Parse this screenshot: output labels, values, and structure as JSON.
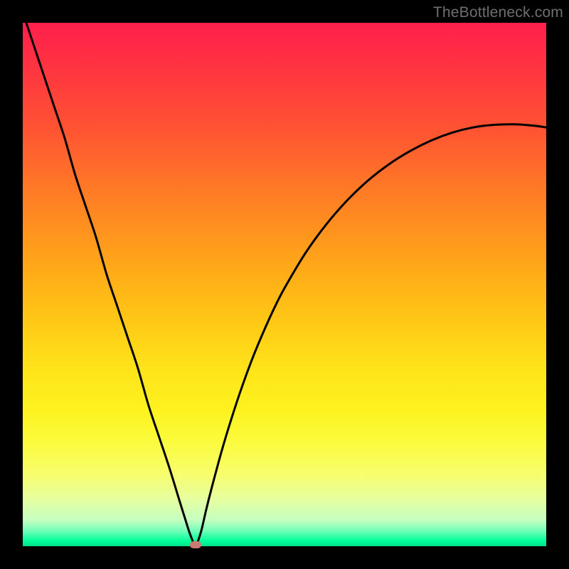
{
  "watermark": "TheBottleneck.com",
  "colors": {
    "frame_bg": "#000000",
    "curve_stroke": "#000000",
    "min_marker": "#c97b72",
    "watermark": "#6f6f6f",
    "gradient_top": "#ff1f4c",
    "gradient_bottom": "#00e089"
  },
  "chart_data": {
    "type": "line",
    "title": "",
    "xlabel": "",
    "ylabel": "",
    "xlim": [
      0,
      100
    ],
    "ylim": [
      0,
      100
    ],
    "x": [
      0,
      2,
      4,
      6,
      8,
      10,
      12,
      14,
      16,
      18,
      20,
      22,
      24,
      26,
      28,
      30,
      31,
      32,
      33,
      34,
      35,
      36,
      38,
      40,
      42,
      44,
      46,
      48,
      50,
      54,
      58,
      62,
      66,
      70,
      74,
      78,
      82,
      86,
      90,
      94,
      98,
      100
    ],
    "values": [
      102,
      96,
      90,
      84,
      78,
      71,
      65,
      59,
      52,
      46,
      40,
      34,
      27,
      21,
      15,
      8.5,
      5.3,
      2.2,
      0.3,
      2.6,
      6.8,
      10.8,
      18.2,
      24.8,
      30.8,
      36.2,
      41.0,
      45.4,
      49.3,
      56.0,
      61.5,
      66.1,
      69.9,
      73.0,
      75.5,
      77.5,
      79.0,
      80.0,
      80.5,
      80.6,
      80.3,
      80.0
    ],
    "minimum": {
      "x": 33,
      "y": 0.3
    },
    "legend": false,
    "grid": false,
    "annotations": []
  }
}
